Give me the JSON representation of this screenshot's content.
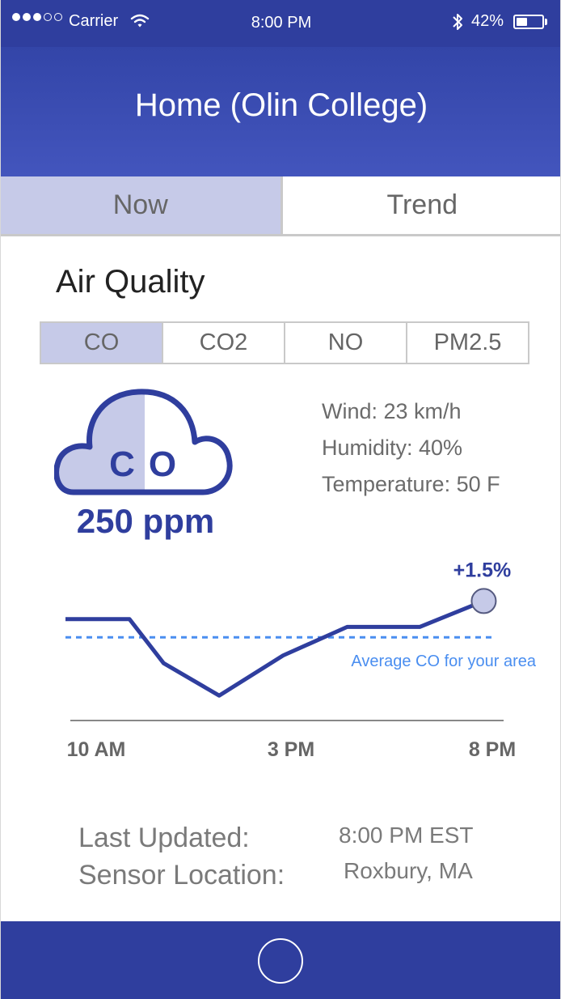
{
  "status_bar": {
    "carrier": "Carrier",
    "time": "8:00 PM",
    "battery": "42%",
    "battery_level": 0.42,
    "signal_bars_filled": 3,
    "signal_bars_total": 5
  },
  "header": {
    "title": "Home (Olin College)"
  },
  "tabs": [
    {
      "label": "Now",
      "active": true
    },
    {
      "label": "Trend",
      "active": false
    }
  ],
  "section": {
    "title": "Air Quality"
  },
  "pollutants": [
    {
      "label": "CO",
      "selected": true
    },
    {
      "label": "CO2",
      "selected": false
    },
    {
      "label": "NO",
      "selected": false
    },
    {
      "label": "PM2.5",
      "selected": false
    }
  ],
  "reading": {
    "pollutant_left": "C",
    "pollutant_right": "O",
    "value": "250 ppm"
  },
  "weather": {
    "wind": "Wind: 23 km/h",
    "humidity": "Humidity: 40%",
    "temperature": "Temperature: 50 F"
  },
  "chart_data": {
    "type": "line",
    "x_tick_labels": [
      "10 AM",
      "3 PM",
      "8 PM"
    ],
    "x": [
      0,
      0.15,
      0.23,
      0.36,
      0.51,
      0.66,
      0.83,
      0.98
    ],
    "series": [
      {
        "values": [
          0.72,
          0.72,
          0.38,
          0.13,
          0.44,
          0.66,
          0.66,
          0.86
        ]
      }
    ],
    "average_line": {
      "label": "Average CO for your area",
      "value": 0.58
    },
    "change_label": "+1.5%",
    "ylim": [
      0,
      1
    ],
    "colors": {
      "line": "#2f3e9e",
      "average": "#4a8ef0",
      "marker": "#c6cae8"
    }
  },
  "info": {
    "last_updated_label": "Last Updated:",
    "last_updated_value": "8:00 PM EST",
    "sensor_location_label": "Sensor Location:",
    "sensor_location_value": "Roxbury, MA"
  },
  "colors": {
    "primary": "#2f3e9e",
    "header": "#3f51b5",
    "selected": "#c6cae8",
    "average_line": "#4a8ef0"
  }
}
